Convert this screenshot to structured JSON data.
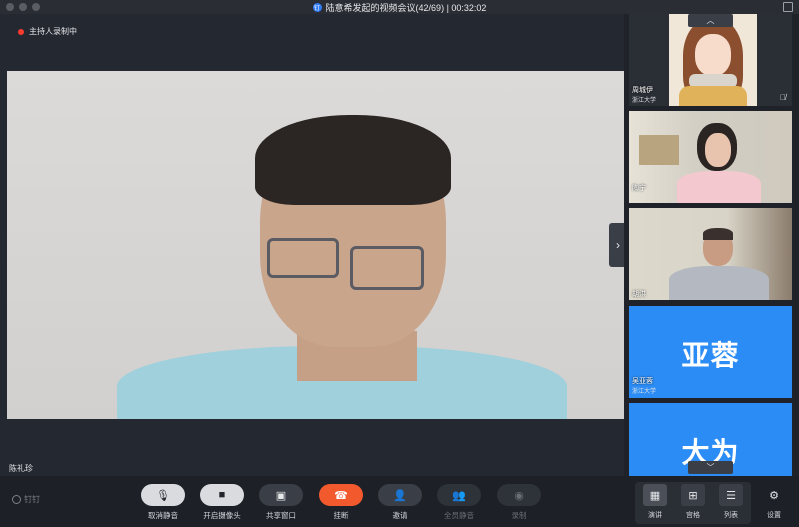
{
  "titlebar": {
    "app_badge": "钉",
    "title": "陆意希发起的视频会议(42/69) | 00:32:02"
  },
  "stage": {
    "recording_label": "主持人录制中",
    "speaker_name": "陈礼珍"
  },
  "sidebar": {
    "participants": [
      {
        "name": "周城伊",
        "org": "浙江大学",
        "kind": "cartoon",
        "muted": true
      },
      {
        "name": "陶宁",
        "org": "",
        "kind": "video-woman"
      },
      {
        "name": "胡洪",
        "org": "",
        "kind": "video-man"
      },
      {
        "name": "吴亚蓉",
        "org": "浙江大学",
        "kind": "text-avatar",
        "avatar_text": "亚蓉"
      },
      {
        "name": "",
        "org": "",
        "kind": "text-avatar",
        "avatar_text": "大为"
      }
    ]
  },
  "toolbar": {
    "brand": "钉钉",
    "buttons": [
      {
        "label": "取消静音",
        "icon": "🎙"
      },
      {
        "label": "开启摄像头",
        "icon": "■"
      },
      {
        "label": "共享窗口",
        "icon": "▣"
      },
      {
        "label": "挂断",
        "icon": "☎"
      },
      {
        "label": "邀请",
        "icon": "👤"
      },
      {
        "label": "全员静音",
        "icon": "👥"
      },
      {
        "label": "录制",
        "icon": "◉"
      }
    ],
    "views": [
      {
        "label": "演讲",
        "icon": "▦"
      },
      {
        "label": "宫格",
        "icon": "⊞"
      },
      {
        "label": "列表",
        "icon": "☰"
      }
    ],
    "settings": {
      "label": "设置",
      "icon": "⚙"
    }
  },
  "colors": {
    "accent_blue": "#2b8cf5",
    "hangup_red": "#f25a2e",
    "record_dot": "#ff3b30"
  }
}
